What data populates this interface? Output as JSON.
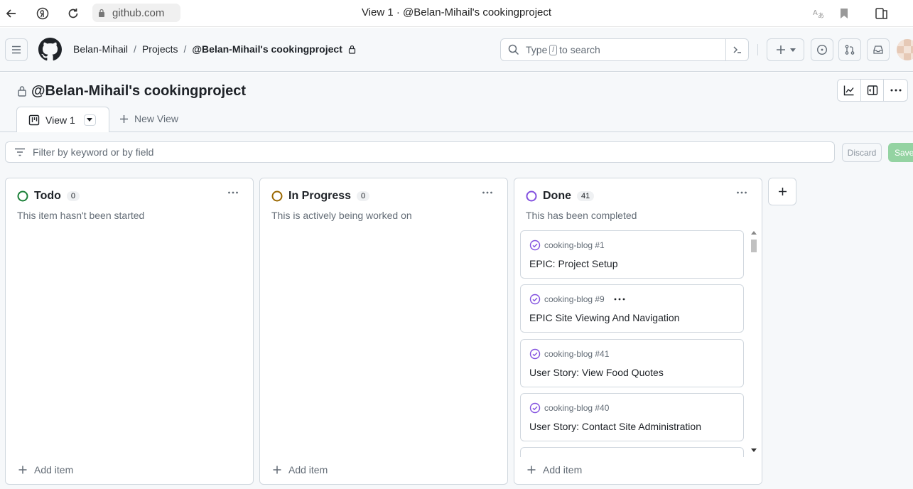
{
  "browser": {
    "url": "github.com",
    "tab_title": "View 1 · @Belan-Mihail's cookingproject"
  },
  "header": {
    "breadcrumbs": [
      "Belan-Mihail",
      "Projects",
      "@Belan-Mihail's cookingproject"
    ],
    "search_prefix": "Type",
    "search_key": "/",
    "search_suffix": "to search"
  },
  "project": {
    "title": "@Belan-Mihail's cookingproject",
    "view_tab": "View 1",
    "new_view": "New View",
    "filter_placeholder": "Filter by keyword or by field",
    "discard": "Discard",
    "save": "Save"
  },
  "columns": [
    {
      "name": "Todo",
      "count": "0",
      "description": "This item hasn't been started",
      "add_item": "Add item",
      "status_color": "#1a7f37"
    },
    {
      "name": "In Progress",
      "count": "0",
      "description": "This is actively being worked on",
      "add_item": "Add item",
      "status_color": "#9a6700"
    },
    {
      "name": "Done",
      "count": "41",
      "description": "This has been completed",
      "add_item": "Add item",
      "status_color": "#8250df",
      "cards": [
        {
          "repo": "cooking-blog #1",
          "title": "EPIC: Project Setup"
        },
        {
          "repo": "cooking-blog #9",
          "title": "EPIC Site Viewing And Navigation"
        },
        {
          "repo": "cooking-blog #41",
          "title": "User Story: View Food Quotes"
        },
        {
          "repo": "cooking-blog #40",
          "title": "User Story: Contact Site Administration"
        }
      ]
    }
  ],
  "icons": [
    "back-arrow-icon",
    "yandex-icon",
    "reload-icon",
    "lock-icon",
    "translate-icon",
    "bookmark-icon",
    "collections-icon",
    "hamburger-icon",
    "github-logo-icon",
    "search-icon",
    "terminal-icon",
    "plus-icon",
    "issues-icon",
    "pull-request-icon",
    "inbox-icon",
    "insights-icon",
    "panel-icon",
    "kebab-icon",
    "board-icon",
    "filter-icon",
    "closed-issue-icon"
  ],
  "colors": {
    "done": "#8250df",
    "save_disabled": "#94d3a2"
  }
}
